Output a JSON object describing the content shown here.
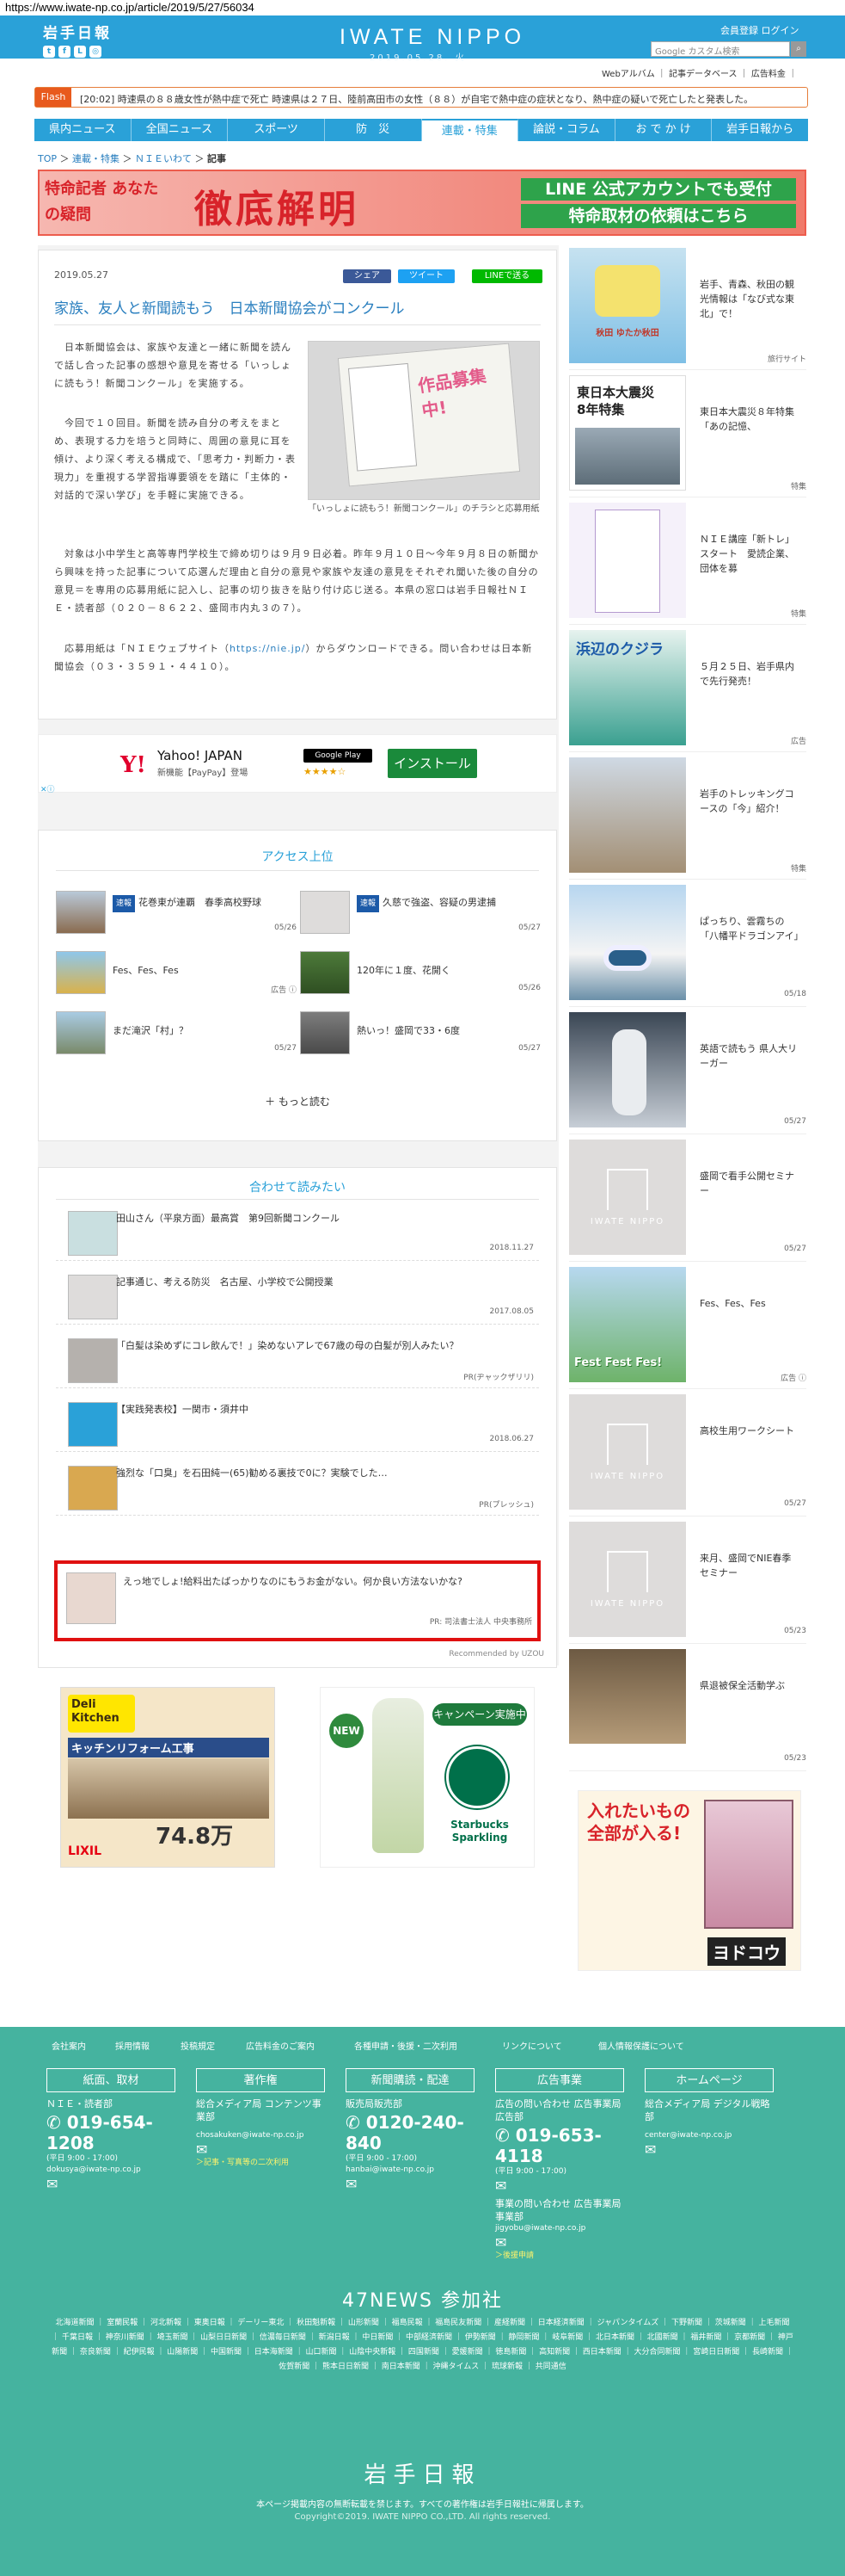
{
  "url": "https://www.iwate-np.co.jp/article/2019/5/27/56034",
  "header": {
    "logo_small": "岩手日報",
    "brand": "IWATE NIPPO",
    "date": "2019.05.28. 火",
    "user_links": "会員登録 ログイン",
    "search_placeholder": "Google カスタム検索",
    "sub_links": "Webアルバム ｜ 記事データベース ｜ 広告料金 ｜"
  },
  "flash": {
    "tag": "Flash",
    "text": "[20:02] 時速県の８８歳女性が熱中症で死亡  時速県は２７日、陸前高田市の女性（８８）が自宅で熱中症の症状となり、熱中症の疑いで死亡したと発表した。"
  },
  "nav": {
    "items": [
      "県内ニュース",
      "全国ニュース",
      "スポーツ",
      "防　災",
      "連載・特集",
      "論説・コラム",
      "お で か け",
      "岩手日報から"
    ]
  },
  "breadcrumb": {
    "top": "TOP",
    "l1": "連載・特集",
    "l2": "ＮＩＥいわて",
    "current": "記事"
  },
  "banner": {
    "left": "特命記者 あなたの疑問",
    "main": "徹底解明",
    "line1": "LINE 公式アカウントでも受付",
    "line2": "特命取材の依頼はこちら"
  },
  "article": {
    "date": "2019.05.27",
    "title": "家族、友人と新聞読もう　日本新聞協会がコンクール",
    "share_fb": "シェア",
    "share_tw": "ツイート",
    "share_line": "LINEで送る",
    "p1": "　日本新聞協会は、家族や友達と一緒に新聞を読んで話し合った記事の感想や意見を寄せる「いっしょに読もう！新聞コンクール」を実施する。",
    "p2": "　今回で１０回目。新聞を読み自分の考えをまとめ、表現する力を培うと同時に、周囲の意見に耳を傾け、より深く考える構成で、「思考力・判断力・表現力」を重視する学習指導要領をを踏に「主体的・対話的で深い学び」を手軽に実施できる。",
    "p3": "　対象は小中学生と高等専門学校生で締め切りは９月９日必着。昨年９月１０日～今年９月８日の新聞から興味を持った記事について応選んだ理由と自分の意見や家族や友達の意見をそれぞれ聞いた後の自分の意見＝を専用の応募用紙に記入し、記事の切り抜きを貼り付け応じ送る。本県の窓口は岩手日報社ＮＩＥ・読者部（０２０－８６２２、盛岡市内丸３の７）。",
    "p4a": "　応募用紙は「ＮＩＥウェブサイト（",
    "p4link": "https://nie.jp/",
    "p4b": "）からダウンロードできる。問い合わせは日本新聞協会（０３・３５９１・４４１０）。",
    "photo_text": "作品募集中!",
    "photo_caption": "「いっしょに読もう！新聞コンクール」のチラシと応募用紙"
  },
  "ad": {
    "logo": "Y!",
    "title": "Yahoo! JAPAN",
    "sub": "新機能【PayPay】登場",
    "gp": "Google Play",
    "stars": "★★★★☆",
    "install": "インストール"
  },
  "access": {
    "title": "アクセス上位",
    "badge": "速報",
    "items": [
      {
        "text": "花巻東が連覇　春季高校野球",
        "date": "05/26",
        "badge": true
      },
      {
        "text": "久慈で強盗、容疑の男逮捕",
        "date": "05/27",
        "badge": true
      },
      {
        "text": "Fes、Fes、Fes",
        "date": "広告 ⓘ",
        "badge": false
      },
      {
        "text": "120年に１度、花開く",
        "date": "05/26",
        "badge": false
      },
      {
        "text": "まだ滝沢「村」？",
        "date": "05/27",
        "badge": false
      },
      {
        "text": "熱いっ！盛岡で33・6度",
        "date": "05/27",
        "badge": false
      }
    ],
    "more": "もっと読む"
  },
  "related": {
    "title": "合わせて読みたい",
    "items": [
      {
        "text": "田山さん（平泉方面）最高賞　第9回新聞コンクール",
        "date": "2018.11.27"
      },
      {
        "text": "記事通じ、考える防災　名古屋、小学校で公開授業",
        "date": "2017.08.05"
      },
      {
        "text": "「白髪は染めずにコレ飲んで！」染めないアレで67歳の母の白髪が別人みたい？",
        "date": "PR(ヂャックザリリ)"
      },
      {
        "text": "【実践発表校】一関市・須井中",
        "date": "2018.06.27"
      },
      {
        "text": "強烈な「口臭」を石田純一(65)勧める裏技で0に？実験でした…",
        "date": "PR(プレッシュ)"
      },
      {
        "text": "えっ地でしょ!給料出たばっかりなのにもうお金がない。何か良い方法ないかな?",
        "date": "PR: 司法書士法人 中央事務所"
      }
    ],
    "recommended": "Recommended by UZOU"
  },
  "ads_bottom": {
    "deli": "Deli Kitchen",
    "deli_sub": "キッチンリフォーム工事",
    "deli_price": "74.8万",
    "deli_brand": "LIXIL",
    "sb_campaign": "キャンペーン実施中",
    "sb_brand": "Starbucks Sparkling",
    "sb_new": "NEW"
  },
  "sidebar": [
    {
      "text": "岩手、青森、秋田の観光情報は「なび式な東北」で！",
      "date": "旅行サイト"
    },
    {
      "text": "東日本大震災８年特集「あの記憶、",
      "date": "特集"
    },
    {
      "text": "ＮＩＥ講座「新トレ」スタート　愛読企業、団体を募",
      "date": "特集"
    },
    {
      "text": "５月２５日、岩手県内で先行発売！",
      "date": "広告"
    },
    {
      "text": "岩手のトレッキングコースの「今」紹介！",
      "date": "特集"
    },
    {
      "text": "ぱっちり、雲霧ちの「八幡平ドラゴンアイ」",
      "date": "05/18"
    },
    {
      "text": "英語で読もう 県人大リーガー",
      "date": "05/27"
    },
    {
      "text": "盛岡で看手公開セミナー",
      "date": "05/27"
    },
    {
      "text": "Fes、Fes、Fes",
      "date": "広告 ⓘ"
    },
    {
      "text": "高校生用ワークシート",
      "date": "05/27"
    },
    {
      "text": "来月、盛岡でNIE春季セミナー",
      "date": "05/23"
    },
    {
      "text": "県退被保全活動学ぶ",
      "date": "05/23"
    }
  ],
  "sidebar_labels": {
    "w1_tag": "秋田 ゆたか秋田",
    "w2_head": "東日本大震災",
    "w2_sub": "8年特集",
    "w4_head": "浜辺のクジラ",
    "placeholder_brand": "IWATE NIPPO",
    "fes": "Fest Fest Fes!",
    "ad_headline": "入れたいもの全部が入る!",
    "ad_brand": "ヨドコウ"
  },
  "footer": {
    "links": [
      "会社案内",
      "採用情報",
      "投稿規定",
      "広告料金のご案内",
      "各種申請・後援・二次利用",
      "リンクについて",
      "個人情報保護について"
    ],
    "cols": [
      {
        "head": "紙面、取材",
        "dept": "ＮＩＥ・読者部",
        "tel": "019-654-1208",
        "hours": "(平日 9:00 - 17:00)",
        "mail": "dokusya@iwate-np.co.jp",
        "extra": ""
      },
      {
        "head": "著作権",
        "dept": "総合メディア局 コンテンツ事業部",
        "tel": "",
        "hours": "",
        "mail": "chosakuken@iwate-np.co.jp",
        "extra": "＞記事・写真等の二次利用"
      },
      {
        "head": "新聞購読・配達",
        "dept": "販売局販売部",
        "tel": "0120-240-840",
        "hours": "(平日 9:00 - 17:00)",
        "mail": "hanbai@iwate-np.co.jp",
        "extra": ""
      },
      {
        "head": "広告事業",
        "dept": "広告の問い合わせ 広告事業局広告部",
        "tel": "019-653-4118",
        "hours": "(平日 9:00 - 17:00)",
        "mail": "jigyobu@iwate-np.co.jp",
        "extra": "＞後援申請"
      },
      {
        "head": "ホームページ",
        "dept": "総合メディア局 デジタル戦略部",
        "tel": "",
        "hours": "",
        "mail": "center@iwate-np.co.jp",
        "extra": ""
      }
    ],
    "jigyo_extra": "事業の問い合わせ 広告事業局事業部",
    "news47": "47NEWS 参加社",
    "media": "北海道新聞 ｜ 室蘭民報 ｜ 河北新報 ｜ 東奥日報 ｜ デーリー東北 ｜ 秋田魁新報 ｜ 山形新聞 ｜ 福島民報 ｜ 福島民友新聞 ｜ 産経新聞 ｜ 日本経済新聞 ｜ ジャパンタイムズ ｜ 下野新聞 ｜ 茨城新聞 ｜ 上毛新聞 ｜ 千葉日報 ｜ 神奈川新聞 ｜ 埼玉新聞 ｜ 山梨日日新聞 ｜ 信濃毎日新聞 ｜ 新潟日報 ｜ 中日新聞 ｜ 中部経済新聞 ｜ 伊勢新聞 ｜ 静岡新聞 ｜ 岐阜新聞 ｜ 北日本新聞 ｜ 北國新聞 ｜ 福井新聞 ｜ 京都新聞 ｜ 神戸新聞 ｜ 奈良新聞 ｜ 紀伊民報 ｜ 山陽新聞 ｜ 中国新聞 ｜ 日本海新聞 ｜ 山口新聞 ｜ 山陰中央新報 ｜ 四国新聞 ｜ 愛媛新聞 ｜ 徳島新聞 ｜ 高知新聞 ｜ 西日本新聞 ｜ 大分合同新聞 ｜ 宮崎日日新聞 ｜ 長崎新聞 ｜ 佐賀新聞 ｜ 熊本日日新聞 ｜ 南日本新聞 ｜ 沖縄タイムス ｜ 琉球新報 ｜ 共同通信",
    "logo": "岩手日報",
    "notice": "本ページ掲載内容の無断転載を禁じます。すべての著作権は岩手日報社に帰属します。",
    "copyright": "Copyright©2019. IWATE NIPPO CO.,LTD. All rights reserved."
  }
}
